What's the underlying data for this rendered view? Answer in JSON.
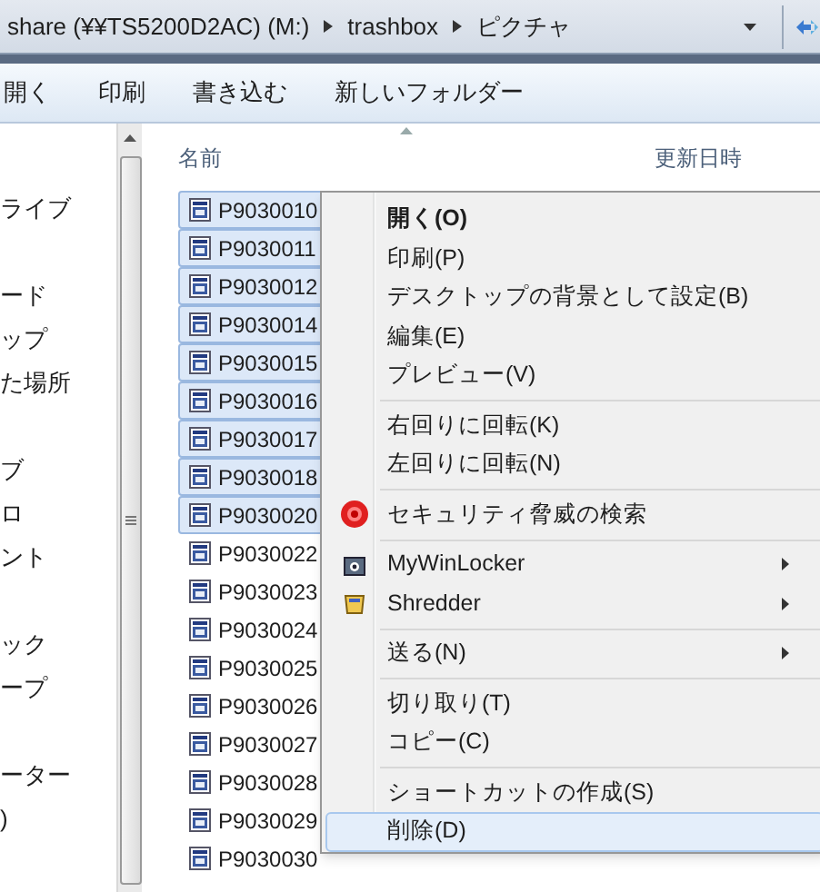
{
  "address_bar": {
    "segments": [
      "share (¥¥TS5200D2AC) (M:)",
      "trashbox",
      "ピクチャ"
    ]
  },
  "toolbar": {
    "items": [
      "開く",
      "印刷",
      "書き込む",
      "新しいフォルダー"
    ]
  },
  "nav_pane": {
    "groups": [
      [
        "ライブ"
      ],
      [
        "ード",
        "ップ",
        "た場所"
      ],
      [
        "ブ",
        "ロ",
        "ント"
      ],
      [
        "ック",
        "ープ"
      ],
      [
        "ーター",
        ")"
      ]
    ]
  },
  "file_list": {
    "columns": [
      "名前",
      "更新日時"
    ],
    "files": [
      {
        "name": "P9030010",
        "selected": true
      },
      {
        "name": "P9030011",
        "selected": true
      },
      {
        "name": "P9030012",
        "selected": true
      },
      {
        "name": "P9030014",
        "selected": true
      },
      {
        "name": "P9030015",
        "selected": true
      },
      {
        "name": "P9030016",
        "selected": true
      },
      {
        "name": "P9030017",
        "selected": true
      },
      {
        "name": "P9030018",
        "selected": true
      },
      {
        "name": "P9030020",
        "selected": true
      },
      {
        "name": "P9030022",
        "selected": false
      },
      {
        "name": "P9030023",
        "selected": false
      },
      {
        "name": "P9030024",
        "selected": false
      },
      {
        "name": "P9030025",
        "selected": false
      },
      {
        "name": "P9030026",
        "selected": false
      },
      {
        "name": "P9030027",
        "selected": false
      },
      {
        "name": "P9030028",
        "selected": false
      },
      {
        "name": "P9030029",
        "selected": false
      },
      {
        "name": "P9030030",
        "selected": false
      }
    ]
  },
  "context_menu": {
    "items": [
      {
        "kind": "item",
        "label": "開く(O)",
        "default": true,
        "selected": false
      },
      {
        "kind": "item",
        "label": "印刷(P)",
        "selected": false
      },
      {
        "kind": "item",
        "label": "デスクトップの背景として設定(B)",
        "selected": false
      },
      {
        "kind": "item",
        "label": "編集(E)",
        "selected": false
      },
      {
        "kind": "item",
        "label": "プレビュー(V)",
        "selected": false
      },
      {
        "kind": "separator"
      },
      {
        "kind": "item",
        "label": "右回りに回転(K)",
        "selected": false
      },
      {
        "kind": "item",
        "label": "左回りに回転(N)",
        "selected": false
      },
      {
        "kind": "separator"
      },
      {
        "kind": "scan-item",
        "label": "セキュリティ脅威の検索",
        "selected": false
      },
      {
        "kind": "separator"
      },
      {
        "kind": "locker-item",
        "label": "MyWinLocker",
        "submenu": true,
        "selected": false
      },
      {
        "kind": "shredder-item",
        "label": "Shredder",
        "submenu": true,
        "selected": false
      },
      {
        "kind": "separator"
      },
      {
        "kind": "item",
        "label": "送る(N)",
        "submenu": true,
        "selected": false
      },
      {
        "kind": "separator"
      },
      {
        "kind": "item",
        "label": "切り取り(T)",
        "selected": false
      },
      {
        "kind": "item",
        "label": "コピー(C)",
        "selected": false
      },
      {
        "kind": "separator"
      },
      {
        "kind": "item",
        "label": "ショートカットの作成(S)",
        "selected": false
      },
      {
        "kind": "item",
        "label": "削除(D)",
        "selected": true
      }
    ]
  }
}
